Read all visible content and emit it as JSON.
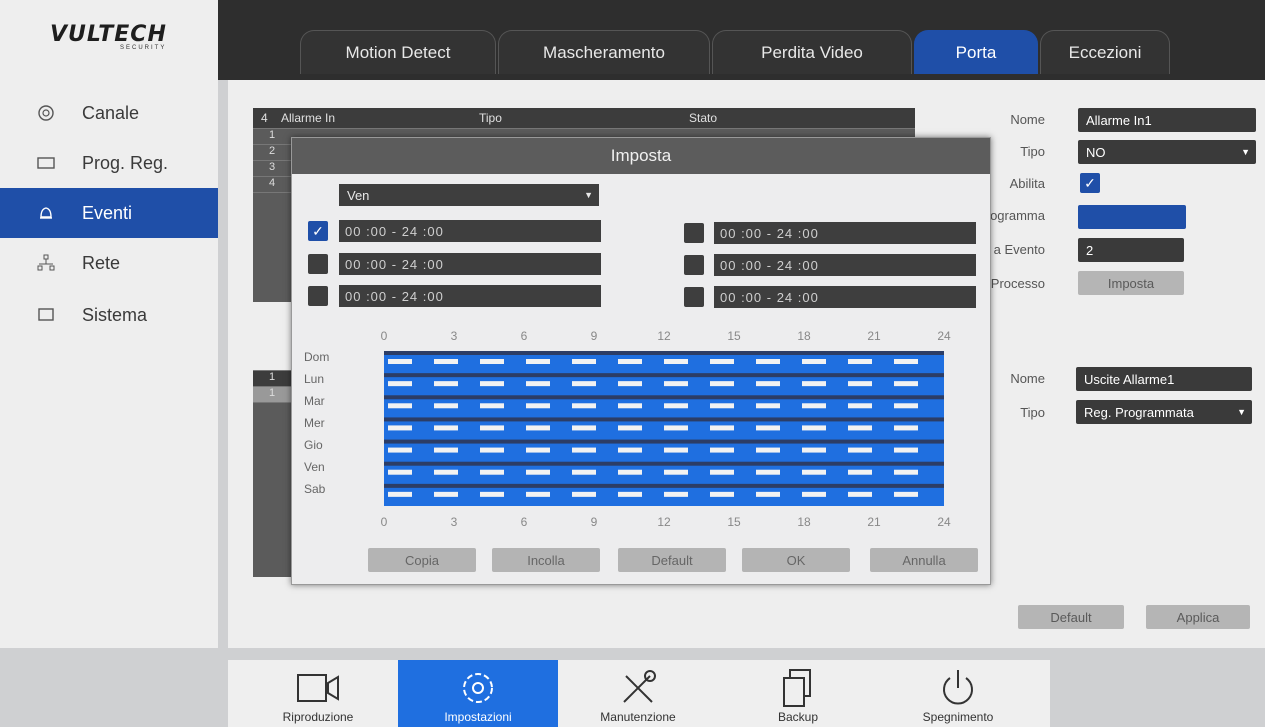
{
  "logo": {
    "brand": "VULTECH",
    "sub": "SECURITY"
  },
  "sidebar": {
    "items": [
      {
        "label": "Canale",
        "icon": "camera-circle-icon"
      },
      {
        "label": "Prog. Reg.",
        "icon": "schedule-icon"
      },
      {
        "label": "Eventi",
        "icon": "bell-icon"
      },
      {
        "label": "Rete",
        "icon": "network-icon"
      },
      {
        "label": "Sistema",
        "icon": "monitor-icon"
      }
    ],
    "active": "Eventi"
  },
  "tabs": [
    "Motion Detect",
    "Mascheramento",
    "Perdita Video",
    "Porta",
    "Eccezioni"
  ],
  "active_tab": "Porta",
  "bg_table": {
    "headers": [
      "4",
      "Allarme In",
      "Tipo",
      "Stato"
    ],
    "rows": [
      "1",
      "2",
      "3",
      "4"
    ]
  },
  "bg_table2": {
    "rows": [
      "1",
      "1"
    ]
  },
  "alarm_in": {
    "nome_label": "Nome",
    "nome_value": "Allarme In1",
    "tipo_label": "Tipo",
    "tipo_value": "NO",
    "abilita_label": "Abilita",
    "programma_label": "ogramma",
    "evento_label": "a Evento",
    "evento_value": "2",
    "processo_label": "Processo",
    "processo_btn": "Imposta"
  },
  "alarm_out": {
    "nome_label": "Nome",
    "nome_value": "Uscite Allarme1",
    "tipo_label": "Tipo",
    "tipo_value": "Reg. Programmata"
  },
  "footer_buttons": {
    "default": "Default",
    "apply": "Applica"
  },
  "dialog": {
    "title": "Imposta",
    "day_select": "Ven",
    "time_slots": [
      {
        "value": "00  :00   -  24  :00",
        "enabled": true
      },
      {
        "value": "00  :00   -  24  :00",
        "enabled": false
      },
      {
        "value": "00  :00   -  24  :00",
        "enabled": false
      },
      {
        "value": "00  :00   -  24  :00",
        "enabled": false
      },
      {
        "value": "00  :00   -  24  :00",
        "enabled": false
      },
      {
        "value": "00  :00   -  24  :00",
        "enabled": false
      }
    ],
    "hours": [
      "0",
      "3",
      "6",
      "9",
      "12",
      "15",
      "18",
      "21",
      "24"
    ],
    "days": [
      "Dom",
      "Lun",
      "Mar",
      "Mer",
      "Gio",
      "Ven",
      "Sab"
    ],
    "buttons": [
      "Copia",
      "Incolla",
      "Default",
      "OK",
      "Annulla"
    ]
  },
  "bottom_bar": [
    {
      "label": "Riproduzione",
      "icon": "video-camera-icon"
    },
    {
      "label": "Impostazioni",
      "icon": "gear-icon"
    },
    {
      "label": "Manutenzione",
      "icon": "tools-icon"
    },
    {
      "label": "Backup",
      "icon": "document-copy-icon"
    },
    {
      "label": "Spegnimento",
      "icon": "power-icon"
    }
  ],
  "active_bottom": "Impostazioni",
  "colors": {
    "accent": "#1f4fa8",
    "grid": "#1f6fe0",
    "dark": "#3e3e3e"
  }
}
